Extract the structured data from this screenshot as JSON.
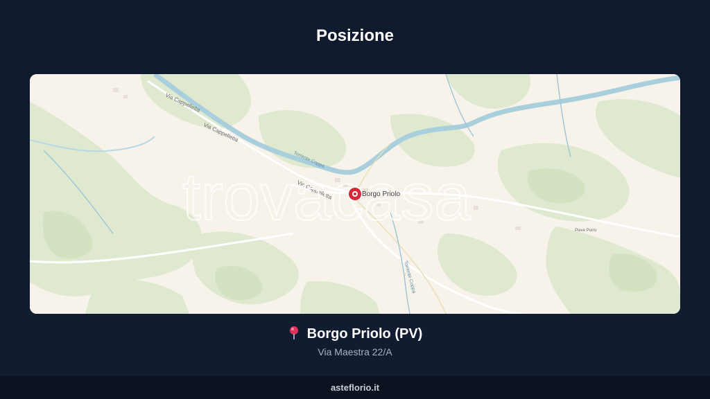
{
  "page": {
    "title": "Posizione"
  },
  "map": {
    "watermark": "trovacasa",
    "marker_label": "Borgo Priolo",
    "street_labels": [
      "Via Cappelletta",
      "Via Cappelletta",
      "Via Cappelletta"
    ],
    "river_labels": [
      "Torrente Coppa",
      "Torrente Coppa"
    ],
    "village_label": "Pieve Porro",
    "colors": {
      "land": "#f7f3ea",
      "green": "#dbe8cc",
      "water": "#9fc6d8",
      "marker": "#d6263b"
    }
  },
  "location": {
    "pin_icon": "map-pin-icon",
    "name": "Borgo Priolo (PV)",
    "address": "Via Maestra 22/A"
  },
  "footer": {
    "site": "asteflorio.it"
  }
}
